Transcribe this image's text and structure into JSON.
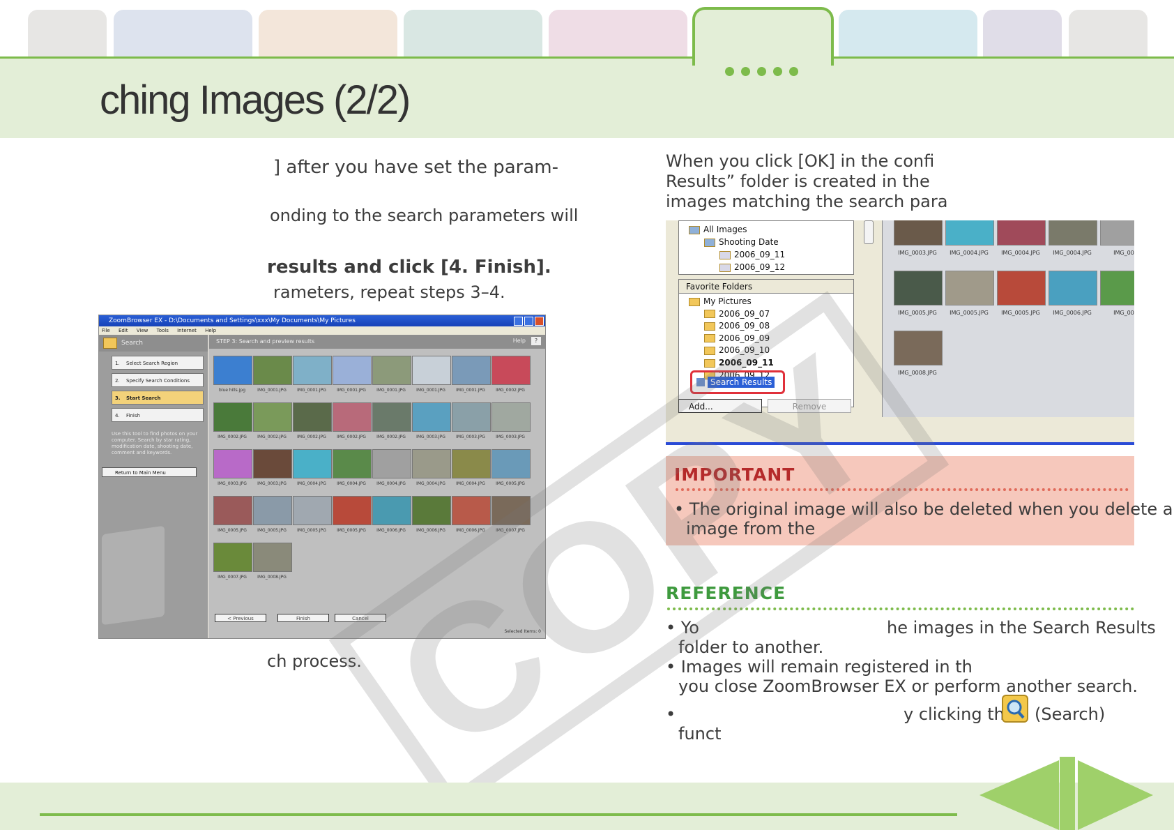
{
  "header": {
    "title": "ching Images (2/2)",
    "tab_colors": [
      "#e7e6e4",
      "#dde3ee",
      "#f3e6da",
      "#d9e7e3",
      "#efdde6",
      "#e3eed7",
      "#d5e9ef",
      "#e0dde8",
      "#e7e6e4"
    ]
  },
  "left": {
    "line1": "] after you have set the param-",
    "line2": "onding to the search parameters will",
    "line3": "results and click [4. Finish].",
    "line4": "rameters, repeat steps 3–4.",
    "line5": "ch process."
  },
  "screenshot": {
    "title_bar": "ZoomBrowser EX - D:\\Documents and Settings\\xxx\\My Documents\\My Pictures",
    "menu": [
      "File",
      "Edit",
      "View",
      "Tools",
      "Internet",
      "Help"
    ],
    "left_header": "Search",
    "steps": [
      {
        "num": "1.",
        "label": "Select Search Region"
      },
      {
        "num": "2.",
        "label": "Specify Search Conditions"
      },
      {
        "num": "3.",
        "label": "Start Search"
      },
      {
        "num": "4.",
        "label": "Finish"
      }
    ],
    "help_text": "Use this tool to find photos on your computer. Search by star rating, modification date, shooting date, comment and keywords.",
    "return_button": "Return to Main Menu",
    "right_header": "STEP 3: Search and preview results",
    "help_label": "Help",
    "thumbnails": [
      "blue hills.jpg",
      "IMG_0001.JPG",
      "IMG_0001.JPG",
      "IMG_0001.JPG",
      "IMG_0001.JPG",
      "IMG_0001.JPG",
      "IMG_0001.JPG",
      "IMG_0002.JPG",
      "IMG_0002.JPG",
      "IMG_0002.JPG",
      "IMG_0002.JPG",
      "IMG_0002.JPG",
      "IMG_0002.JPG",
      "IMG_0003.JPG",
      "IMG_0003.JPG",
      "IMG_0003.JPG",
      "IMG_0003.JPG",
      "IMG_0003.JPG",
      "IMG_0004.JPG",
      "IMG_0004.JPG",
      "IMG_0004.JPG",
      "IMG_0004.JPG",
      "IMG_0004.JPG",
      "IMG_0005.JPG",
      "IMG_0005.JPG",
      "IMG_0005.JPG",
      "IMG_0005.JPG",
      "IMG_0005.JPG",
      "IMG_0006.JPG",
      "IMG_0006.JPG",
      "IMG_0006.JPG",
      "IMG_0007.JPG",
      "IMG_0007.JPG",
      "IMG_0008.JPG"
    ],
    "thumb_colors": [
      "#3c7fd0",
      "#6a8a4a",
      "#7fb0c8",
      "#9ab0d8",
      "#8c9a7a",
      "#c8d0d8",
      "#7a9ab8",
      "#c84a5a",
      "#4a7a3a",
      "#7a9a5a",
      "#5a6a4a",
      "#b86a7a",
      "#6a7a6a",
      "#5aa0c0",
      "#8aa0a8",
      "#a0a8a0",
      "#b86ac8",
      "#6a4a3a",
      "#4ab0c8",
      "#5a8a4a",
      "#a0a0a0",
      "#9a9a8a",
      "#8a8a4a",
      "#6a9ab8",
      "#9a5a5a",
      "#8a9aa8",
      "#a0a8b0",
      "#b84a3a",
      "#4a9ab0",
      "#5a7a3a",
      "#b85a4a",
      "#7a6a5a",
      "#6a8a3a",
      "#8a8a7a"
    ],
    "prev_button": "< Previous",
    "finish_button": "Finish",
    "cancel_button": "Cancel",
    "status": "Selected Items: 0"
  },
  "right": {
    "para1": "When you click [OK] in the confi",
    "para2": "Results” folder is created in the",
    "para3": "images matching the search para"
  },
  "explorer": {
    "tree_top": [
      {
        "label": "All Images",
        "indent": 0
      },
      {
        "label": "Shooting Date",
        "indent": 1
      },
      {
        "label": "2006_09_11",
        "indent": 2
      },
      {
        "label": "2006_09_12",
        "indent": 2
      }
    ],
    "favorites_header": "Favorite Folders",
    "tree_fav": [
      {
        "label": "My Pictures",
        "indent": 0
      },
      {
        "label": "2006_09_07",
        "indent": 1
      },
      {
        "label": "2006_09_08",
        "indent": 1
      },
      {
        "label": "2006_09_09",
        "indent": 1
      },
      {
        "label": "2006_09_10",
        "indent": 1
      },
      {
        "label": "2006_09_11",
        "indent": 1
      },
      {
        "label": "2006_09_12",
        "indent": 1
      }
    ],
    "search_results": "Search Results",
    "add_button": "Add...",
    "remove_button": "Remove",
    "images": [
      "IMG_0003.JPG",
      "IMG_0004.JPG",
      "IMG_0004.JPG",
      "IMG_0004.JPG",
      "IMG_00",
      "IMG_0005.JPG",
      "IMG_0005.JPG",
      "IMG_0005.JPG",
      "IMG_0006.JPG",
      "IMG_00",
      "IMG_0008.JPG"
    ],
    "image_colors": [
      "#6a5a4a",
      "#4ab0c8",
      "#a04a5a",
      "#7a7a6a",
      "#a0a0a0",
      "#4a5a4a",
      "#a09a8a",
      "#b84a3a",
      "#4aa0c0",
      "#5a9a4a",
      "#7a6a5a"
    ]
  },
  "important": {
    "title": "IMPORTANT",
    "bullet_line1a": "The original image will also be ",
    "bullet_line1b": "deleted when you delete an",
    "bullet_line2": "image from the"
  },
  "reference": {
    "title": "REFERENCE",
    "b1_start": "Yo",
    "b1_end": "he images in the Search Results",
    "b1_line2": "folder to another.",
    "b2_line1": "Images will remain registered in th",
    "b2_line2": "you close ZoomBrowser EX or perform another search.",
    "b3_end": "y clicking the",
    "b3_search": "(Search)",
    "b3_line2": "funct"
  },
  "watermark": "COPY"
}
